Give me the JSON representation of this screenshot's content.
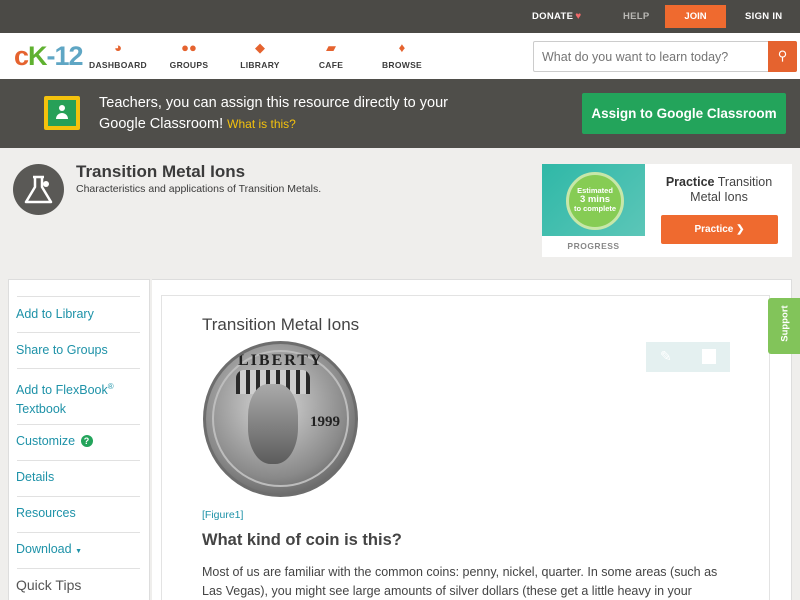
{
  "topbar": {
    "donate_label": "DONATE",
    "help_label": "HELP",
    "join_label": "JOIN",
    "signin_label": "SIGN IN"
  },
  "nav": {
    "logo": {
      "part1": "c",
      "part2": "K",
      "part3": "-12"
    },
    "items": [
      {
        "label": "DASHBOARD",
        "icon": "dashboard-icon"
      },
      {
        "label": "GROUPS",
        "icon": "groups-icon"
      },
      {
        "label": "LIBRARY",
        "icon": "library-icon"
      },
      {
        "label": "CAFE",
        "icon": "cafe-icon"
      },
      {
        "label": "BROWSE",
        "icon": "browse-icon"
      }
    ],
    "search": {
      "placeholder": "What do you want to learn today?"
    }
  },
  "banner": {
    "text": "Teachers, you can assign this resource directly to your Google Classroom!",
    "what_is_this": "What is this?",
    "assign_label": "Assign to Google Classroom"
  },
  "concept": {
    "title": "Transition Metal Ions",
    "subtitle": "Characteristics and applications of Transition Metals."
  },
  "practice": {
    "estimate_line1": "Estimated",
    "estimate_mins": "3 mins",
    "estimate_line3": "to complete",
    "progress_label": "PROGRESS",
    "title_bold": "Practice",
    "title_rest": "Transition Metal Ions",
    "button_label": "Practice"
  },
  "sidebar": {
    "add_to_library": "Add to Library",
    "share_to_groups": "Share to Groups",
    "add_to_flexbook": "Add to FlexBook",
    "add_to_flexbook_reg": "®",
    "add_to_flexbook_line2": "Textbook",
    "customize": "Customize",
    "customize_help": "?",
    "details": "Details",
    "resources": "Resources",
    "download": "Download",
    "download_caret": "▼",
    "quick_tips": "Quick Tips"
  },
  "lesson": {
    "title": "Transition Metal Ions",
    "coin_text": "LIBERTY",
    "coin_year": "1999",
    "figure_label": "[Figure1]",
    "question": "What kind of coin is this?",
    "paragraph": "Most of us are familiar with the common coins: penny, nickel, quarter.  In some areas (such as Las Vegas), you might see large amounts of silver dollars (these get a little heavy in your"
  },
  "support_label": "Support",
  "colors": {
    "accent_orange": "#ef6a2f",
    "link_teal": "#1e92a8",
    "google_green": "#23a45b",
    "dark_bar": "#4b4a46"
  }
}
